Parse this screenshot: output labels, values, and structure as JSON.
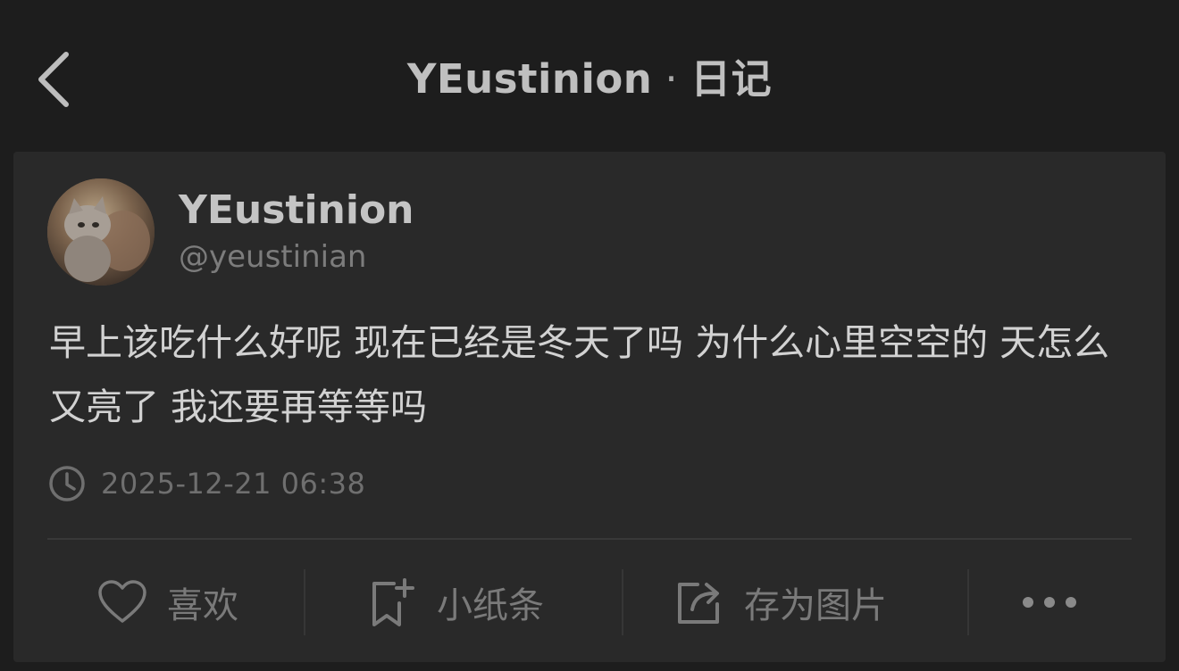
{
  "header": {
    "title_name": "YEustinion",
    "title_separator": "·",
    "title_section": "日记"
  },
  "post": {
    "display_name": "YEustinion",
    "handle": "@yeustinian",
    "content": "早上该吃什么好呢 现在已经是冬天了吗 为什么心里空空的 天怎么又亮了 我还要再等等吗",
    "timestamp": "2025-12-21 06:38"
  },
  "actions": {
    "like_label": "喜欢",
    "note_label": "小纸条",
    "save_image_label": "存为图片"
  },
  "icons": {
    "back": "chevron-left-icon",
    "clock": "clock-icon",
    "like": "heart-icon",
    "note": "bookmark-plus-icon",
    "save_image": "share-out-icon",
    "more": "more-dots-icon"
  },
  "colors": {
    "background": "#1d1d1d",
    "card": "#292929",
    "primary_text": "#d2d2d2",
    "secondary_text": "#7a7a7a"
  }
}
